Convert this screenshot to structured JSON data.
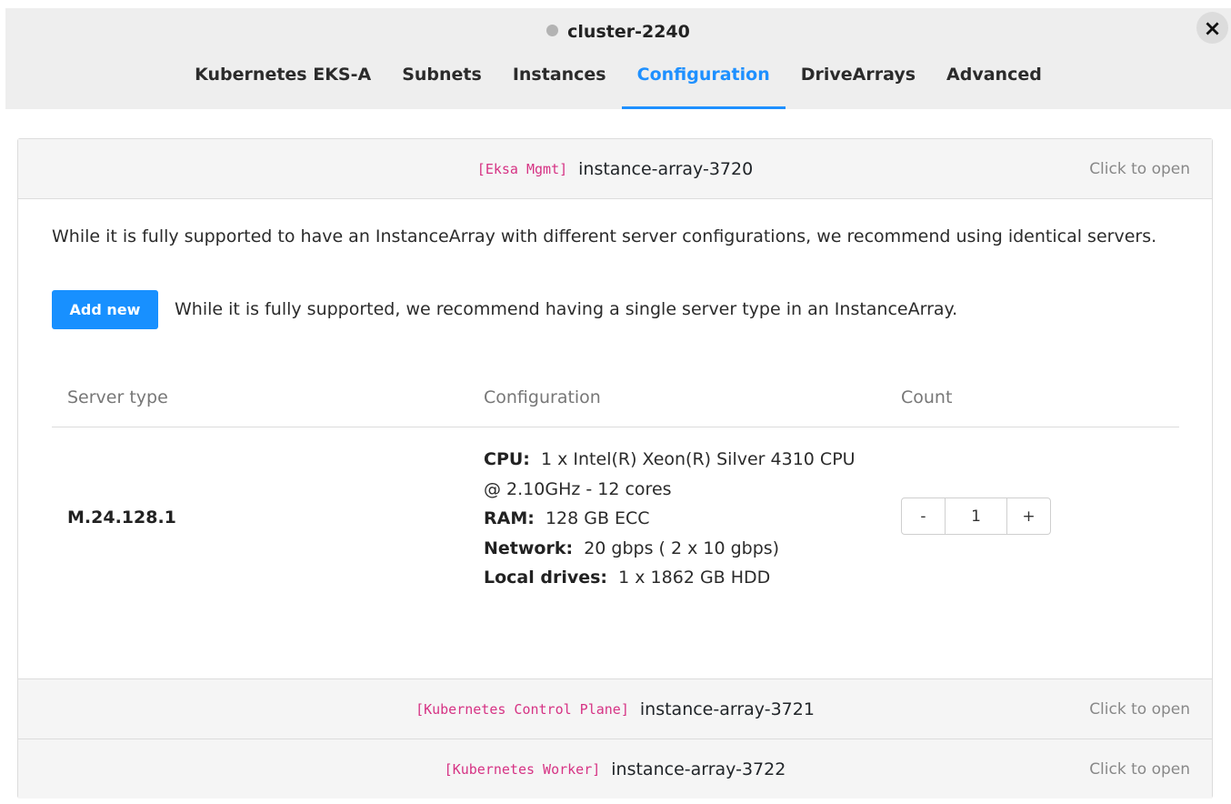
{
  "header": {
    "title": "cluster-2240",
    "close_icon": "×"
  },
  "tabs": [
    {
      "label": "Kubernetes EKS-A"
    },
    {
      "label": "Subnets"
    },
    {
      "label": "Instances"
    },
    {
      "label": "Configuration",
      "active": true
    },
    {
      "label": "DriveArrays"
    },
    {
      "label": "Advanced"
    }
  ],
  "colors": {
    "accent": "#1890ff",
    "tag": "#d63384",
    "status_dot": "#b3b3b3"
  },
  "accordion": [
    {
      "tag": "[Eksa Mgmt]",
      "name": "instance-array-3720",
      "hint": "Click to open"
    },
    {
      "tag": "[Kubernetes Control Plane]",
      "name": "instance-array-3721",
      "hint": "Click to open"
    },
    {
      "tag": "[Kubernetes Worker]",
      "name": "instance-array-3722",
      "hint": "Click to open"
    }
  ],
  "body": {
    "info": "While it is fully supported to have an InstanceArray with different server configurations, we recommend using identical servers.",
    "add_label": "Add new",
    "add_note": "While it is fully supported, we recommend having a single server type in an InstanceArray."
  },
  "table": {
    "headers": [
      "Server type",
      "Configuration",
      "Count"
    ],
    "row": {
      "server_type": "M.24.128.1",
      "cpu_label": "CPU:",
      "cpu": "1 x Intel(R) Xeon(R) Silver 4310 CPU @ 2.10GHz - 12 cores",
      "ram_label": "RAM:",
      "ram": "128 GB ECC",
      "network_label": "Network:",
      "network": "20 gbps ( 2 x 10 gbps)",
      "drives_label": "Local drives:",
      "drives": "1 x 1862 GB HDD",
      "count": "1",
      "minus": "-",
      "plus": "+"
    }
  }
}
